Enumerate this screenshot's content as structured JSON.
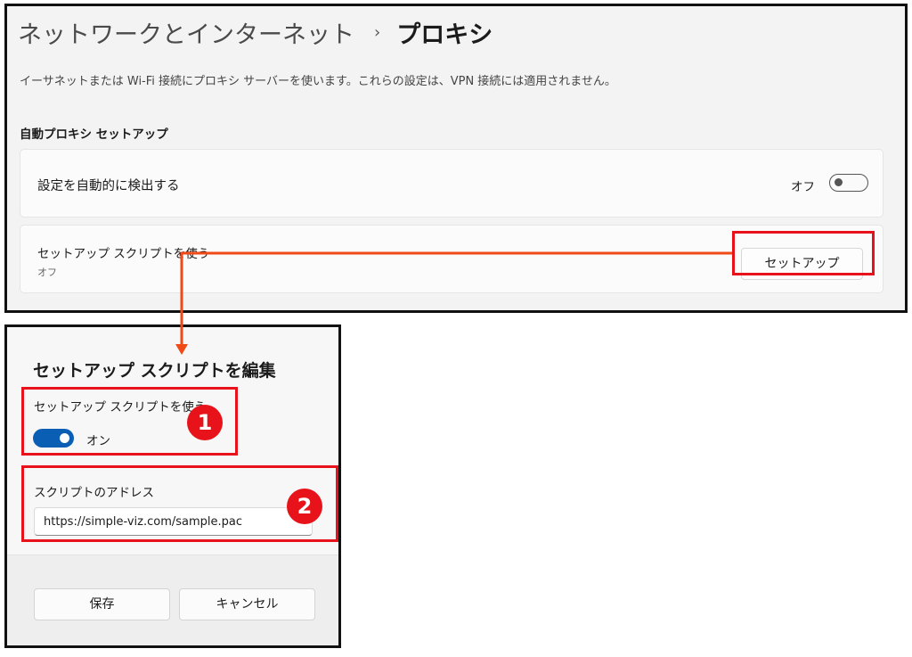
{
  "settings": {
    "breadcrumb": {
      "parent": "ネットワークとインターネット",
      "separator": "›",
      "current": "プロキシ"
    },
    "description": "イーサネットまたは Wi-Fi 接続にプロキシ サーバーを使います。これらの設定は、VPN 接続には適用されません。",
    "section_title": "自動プロキシ セットアップ",
    "auto_detect": {
      "label": "設定を自動的に検出する",
      "state": "オフ"
    },
    "setup_script": {
      "label": "セットアップ スクリプトを使う",
      "status": "オフ",
      "button": "セットアップ"
    }
  },
  "dialog": {
    "title": "セットアップ スクリプトを編集",
    "use_script": {
      "label": "セットアップ スクリプトを使う",
      "state": "オン"
    },
    "address": {
      "label": "スクリプトのアドレス",
      "value": "https://simple-viz.com/sample.pac"
    },
    "save": "保存",
    "cancel": "キャンセル"
  },
  "markers": {
    "one": "1",
    "two": "2"
  },
  "colors": {
    "highlight": "#e8131a",
    "connector": "#f04a16",
    "accent": "#0a5fb4"
  }
}
